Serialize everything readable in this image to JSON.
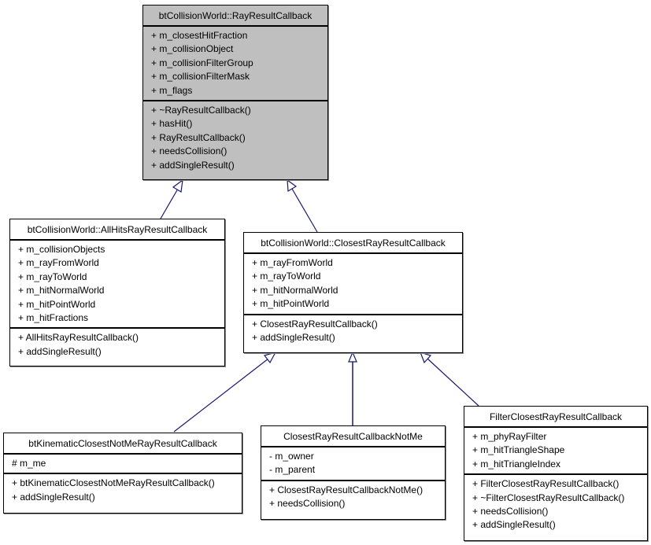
{
  "classes": {
    "rayResultCallback": {
      "name": "btCollisionWorld::RayResultCallback",
      "attributes": [
        "+ m_closestHitFraction",
        "+ m_collisionObject",
        "+ m_collisionFilterGroup",
        "+ m_collisionFilterMask",
        "+ m_flags"
      ],
      "methods": [
        "+ ~RayResultCallback()",
        "+ hasHit()",
        "+ RayResultCallback()",
        "+ needsCollision()",
        "+ addSingleResult()"
      ]
    },
    "allHits": {
      "name": "btCollisionWorld::AllHitsRayResultCallback",
      "attributes": [
        "+ m_collisionObjects",
        "+ m_rayFromWorld",
        "+ m_rayToWorld",
        "+ m_hitNormalWorld",
        "+ m_hitPointWorld",
        "+ m_hitFractions"
      ],
      "methods": [
        "+ AllHitsRayResultCallback()",
        "+ addSingleResult()"
      ]
    },
    "closest": {
      "name": "btCollisionWorld::ClosestRayResultCallback",
      "attributes": [
        "+ m_rayFromWorld",
        "+ m_rayToWorld",
        "+ m_hitNormalWorld",
        "+ m_hitPointWorld"
      ],
      "methods": [
        "+ ClosestRayResultCallback()",
        "+ addSingleResult()"
      ]
    },
    "kinematic": {
      "name": "btKinematicClosestNotMeRayResultCallback",
      "attributes": [
        "# m_me"
      ],
      "methods": [
        "+ btKinematicClosestNotMeRayResultCallback()",
        "+ addSingleResult()"
      ]
    },
    "notMe": {
      "name": "ClosestRayResultCallbackNotMe",
      "attributes": [
        "- m_owner",
        "- m_parent"
      ],
      "methods": [
        "+ ClosestRayResultCallbackNotMe()",
        "+ needsCollision()"
      ]
    },
    "filter": {
      "name": "FilterClosestRayResultCallback",
      "attributes": [
        "+ m_phyRayFilter",
        "+ m_hitTriangleShape",
        "+ m_hitTriangleIndex"
      ],
      "methods": [
        "+ FilterClosestRayResultCallback()",
        "+ ~FilterClosestRayResultCallback()",
        "+ needsCollision()",
        "+ addSingleResult()"
      ]
    }
  },
  "inheritance": [
    {
      "child": "allHits",
      "parent": "rayResultCallback"
    },
    {
      "child": "closest",
      "parent": "rayResultCallback"
    },
    {
      "child": "kinematic",
      "parent": "closest"
    },
    {
      "child": "notMe",
      "parent": "closest"
    },
    {
      "child": "filter",
      "parent": "closest"
    }
  ],
  "colors": {
    "edge": "#191970",
    "base_fill": "#bfbfbf",
    "class_fill": "#ffffff"
  }
}
